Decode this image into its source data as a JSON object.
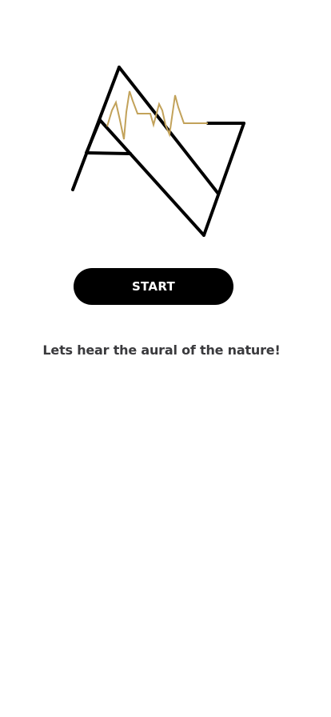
{
  "app": {
    "logo_icon": "mountain-soundwave-logo",
    "colors": {
      "background": "#ffffff",
      "logo_stroke": "#000000",
      "wave_stroke": "#c2a25a",
      "button_bg": "#000000",
      "button_text": "#ffffff",
      "tagline_text": "#3a3a3d"
    }
  },
  "start_button": {
    "label": "START"
  },
  "tagline": {
    "text": "Lets hear the aural of the nature!"
  }
}
